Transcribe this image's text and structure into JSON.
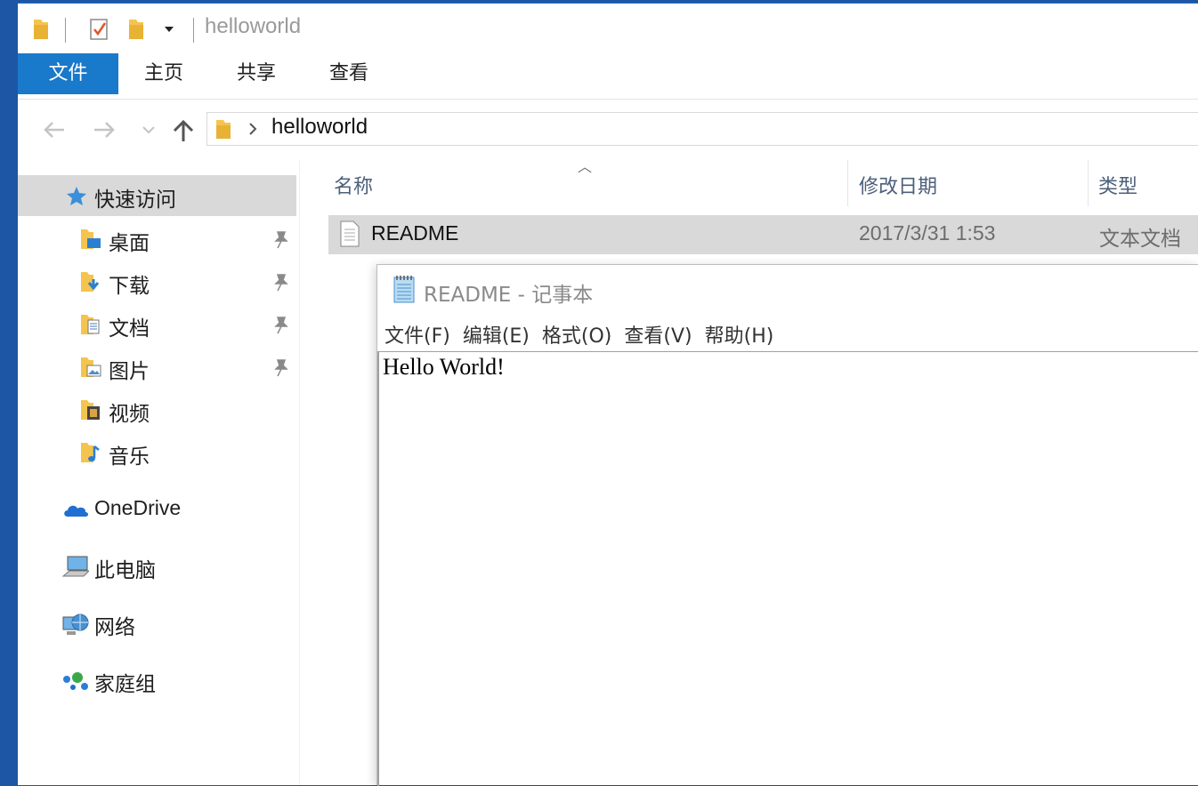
{
  "window": {
    "title": "helloworld"
  },
  "ribbon": {
    "tabs": [
      "文件",
      "主页",
      "共享",
      "查看"
    ]
  },
  "address": {
    "path": "helloworld"
  },
  "sidebar": {
    "quick_access": "快速访问",
    "pinned": [
      "桌面",
      "下载",
      "文档",
      "图片"
    ],
    "unpinned": [
      "视频",
      "音乐"
    ],
    "onedrive": "OneDrive",
    "this_pc": "此电脑",
    "network": "网络",
    "homegroup": "家庭组"
  },
  "columns": {
    "name": "名称",
    "modified": "修改日期",
    "type": "类型"
  },
  "files": [
    {
      "name": "README",
      "modified": "2017/3/31 1:53",
      "type": "文本文档"
    }
  ],
  "notepad": {
    "title": "README - 记事本",
    "menu": [
      "文件(F)",
      "编辑(E)",
      "格式(O)",
      "查看(V)",
      "帮助(H)"
    ],
    "text": "Hello World!"
  },
  "colors": {
    "accent": "#1979ca",
    "selection": "#d9d9d9",
    "header_text": "#4c607a"
  },
  "icons": [
    "folder-icon",
    "checkmark-icon",
    "dropdown-icon",
    "back-arrow-icon",
    "forward-arrow-icon",
    "up-arrow-icon",
    "star-icon",
    "pin-icon",
    "onedrive-cloud-icon",
    "computer-icon",
    "network-icon",
    "homegroup-icon",
    "text-file-icon",
    "notepad-icon"
  ]
}
